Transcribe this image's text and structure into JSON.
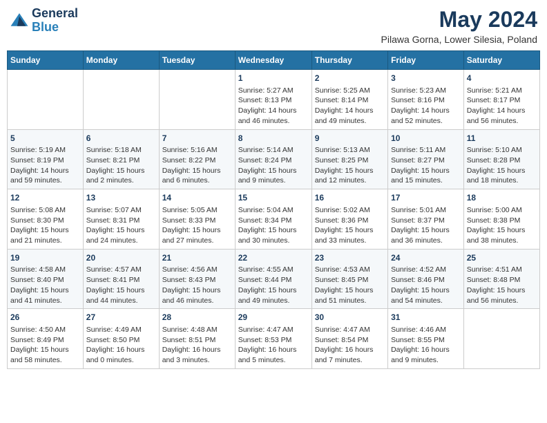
{
  "logo": {
    "line1": "General",
    "line2": "Blue"
  },
  "title": "May 2024",
  "subtitle": "Pilawa Gorna, Lower Silesia, Poland",
  "weekdays": [
    "Sunday",
    "Monday",
    "Tuesday",
    "Wednesday",
    "Thursday",
    "Friday",
    "Saturday"
  ],
  "weeks": [
    [
      {
        "day": "",
        "content": ""
      },
      {
        "day": "",
        "content": ""
      },
      {
        "day": "",
        "content": ""
      },
      {
        "day": "1",
        "content": "Sunrise: 5:27 AM\nSunset: 8:13 PM\nDaylight: 14 hours\nand 46 minutes."
      },
      {
        "day": "2",
        "content": "Sunrise: 5:25 AM\nSunset: 8:14 PM\nDaylight: 14 hours\nand 49 minutes."
      },
      {
        "day": "3",
        "content": "Sunrise: 5:23 AM\nSunset: 8:16 PM\nDaylight: 14 hours\nand 52 minutes."
      },
      {
        "day": "4",
        "content": "Sunrise: 5:21 AM\nSunset: 8:17 PM\nDaylight: 14 hours\nand 56 minutes."
      }
    ],
    [
      {
        "day": "5",
        "content": "Sunrise: 5:19 AM\nSunset: 8:19 PM\nDaylight: 14 hours\nand 59 minutes."
      },
      {
        "day": "6",
        "content": "Sunrise: 5:18 AM\nSunset: 8:21 PM\nDaylight: 15 hours\nand 2 minutes."
      },
      {
        "day": "7",
        "content": "Sunrise: 5:16 AM\nSunset: 8:22 PM\nDaylight: 15 hours\nand 6 minutes."
      },
      {
        "day": "8",
        "content": "Sunrise: 5:14 AM\nSunset: 8:24 PM\nDaylight: 15 hours\nand 9 minutes."
      },
      {
        "day": "9",
        "content": "Sunrise: 5:13 AM\nSunset: 8:25 PM\nDaylight: 15 hours\nand 12 minutes."
      },
      {
        "day": "10",
        "content": "Sunrise: 5:11 AM\nSunset: 8:27 PM\nDaylight: 15 hours\nand 15 minutes."
      },
      {
        "day": "11",
        "content": "Sunrise: 5:10 AM\nSunset: 8:28 PM\nDaylight: 15 hours\nand 18 minutes."
      }
    ],
    [
      {
        "day": "12",
        "content": "Sunrise: 5:08 AM\nSunset: 8:30 PM\nDaylight: 15 hours\nand 21 minutes."
      },
      {
        "day": "13",
        "content": "Sunrise: 5:07 AM\nSunset: 8:31 PM\nDaylight: 15 hours\nand 24 minutes."
      },
      {
        "day": "14",
        "content": "Sunrise: 5:05 AM\nSunset: 8:33 PM\nDaylight: 15 hours\nand 27 minutes."
      },
      {
        "day": "15",
        "content": "Sunrise: 5:04 AM\nSunset: 8:34 PM\nDaylight: 15 hours\nand 30 minutes."
      },
      {
        "day": "16",
        "content": "Sunrise: 5:02 AM\nSunset: 8:36 PM\nDaylight: 15 hours\nand 33 minutes."
      },
      {
        "day": "17",
        "content": "Sunrise: 5:01 AM\nSunset: 8:37 PM\nDaylight: 15 hours\nand 36 minutes."
      },
      {
        "day": "18",
        "content": "Sunrise: 5:00 AM\nSunset: 8:38 PM\nDaylight: 15 hours\nand 38 minutes."
      }
    ],
    [
      {
        "day": "19",
        "content": "Sunrise: 4:58 AM\nSunset: 8:40 PM\nDaylight: 15 hours\nand 41 minutes."
      },
      {
        "day": "20",
        "content": "Sunrise: 4:57 AM\nSunset: 8:41 PM\nDaylight: 15 hours\nand 44 minutes."
      },
      {
        "day": "21",
        "content": "Sunrise: 4:56 AM\nSunset: 8:43 PM\nDaylight: 15 hours\nand 46 minutes."
      },
      {
        "day": "22",
        "content": "Sunrise: 4:55 AM\nSunset: 8:44 PM\nDaylight: 15 hours\nand 49 minutes."
      },
      {
        "day": "23",
        "content": "Sunrise: 4:53 AM\nSunset: 8:45 PM\nDaylight: 15 hours\nand 51 minutes."
      },
      {
        "day": "24",
        "content": "Sunrise: 4:52 AM\nSunset: 8:46 PM\nDaylight: 15 hours\nand 54 minutes."
      },
      {
        "day": "25",
        "content": "Sunrise: 4:51 AM\nSunset: 8:48 PM\nDaylight: 15 hours\nand 56 minutes."
      }
    ],
    [
      {
        "day": "26",
        "content": "Sunrise: 4:50 AM\nSunset: 8:49 PM\nDaylight: 15 hours\nand 58 minutes."
      },
      {
        "day": "27",
        "content": "Sunrise: 4:49 AM\nSunset: 8:50 PM\nDaylight: 16 hours\nand 0 minutes."
      },
      {
        "day": "28",
        "content": "Sunrise: 4:48 AM\nSunset: 8:51 PM\nDaylight: 16 hours\nand 3 minutes."
      },
      {
        "day": "29",
        "content": "Sunrise: 4:47 AM\nSunset: 8:53 PM\nDaylight: 16 hours\nand 5 minutes."
      },
      {
        "day": "30",
        "content": "Sunrise: 4:47 AM\nSunset: 8:54 PM\nDaylight: 16 hours\nand 7 minutes."
      },
      {
        "day": "31",
        "content": "Sunrise: 4:46 AM\nSunset: 8:55 PM\nDaylight: 16 hours\nand 9 minutes."
      },
      {
        "day": "",
        "content": ""
      }
    ]
  ]
}
